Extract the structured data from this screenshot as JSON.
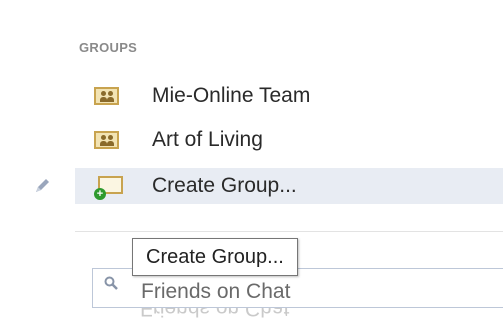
{
  "sidebar": {
    "section_title": "GROUPS",
    "items": [
      {
        "label": "Mie-Online Team",
        "icon": "group-icon"
      },
      {
        "label": "Art of Living",
        "icon": "group-icon"
      },
      {
        "label": "Create Group...",
        "icon": "create-group-icon",
        "selected": true
      }
    ],
    "edit_icon": "pencil-icon"
  },
  "tooltip": {
    "text": "Create Group..."
  },
  "chat_search": {
    "placeholder": "Friends on Chat",
    "icon": "search-icon"
  },
  "colors": {
    "selected_row": "#e8ecf3",
    "section_title": "#8a8a8a",
    "plus_green": "#2e9a2e"
  }
}
